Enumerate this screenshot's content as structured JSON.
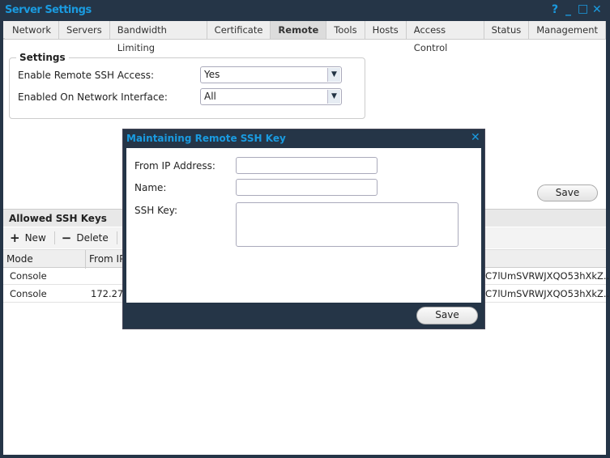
{
  "window": {
    "title": "Server Settings",
    "controls": [
      "?",
      "_",
      "□",
      "✕"
    ]
  },
  "tabs": [
    "Network",
    "Servers",
    "Bandwidth Limiting",
    "Certificate",
    "Remote",
    "Tools",
    "Hosts",
    "Access Control",
    "Status",
    "Management"
  ],
  "active_tab": "Remote",
  "settings": {
    "legend": "Settings",
    "ssh_label": "Enable Remote SSH Access:",
    "ssh_value": "Yes",
    "iface_label": "Enabled On Network Interface:",
    "iface_value": "All",
    "save": "Save"
  },
  "keys": {
    "title": "Allowed SSH Keys",
    "new": "New",
    "delete": "Delete",
    "columns": [
      "Mode",
      "From IP"
    ],
    "rows": [
      {
        "mode": "Console",
        "ip": "",
        "key": "C7lUmSVRWJXQO53hXkZ..."
      },
      {
        "mode": "Console",
        "ip": "172.27.",
        "key": "C7lUmSVRWJXQO53hXkZ..."
      }
    ]
  },
  "modal": {
    "title": "Maintaining Remote SSH Key",
    "from_ip": "From IP Address:",
    "name": "Name:",
    "ssh_key": "SSH Key:",
    "save": "Save",
    "from_ip_value": "",
    "name_value": "",
    "ssh_key_value": ""
  }
}
